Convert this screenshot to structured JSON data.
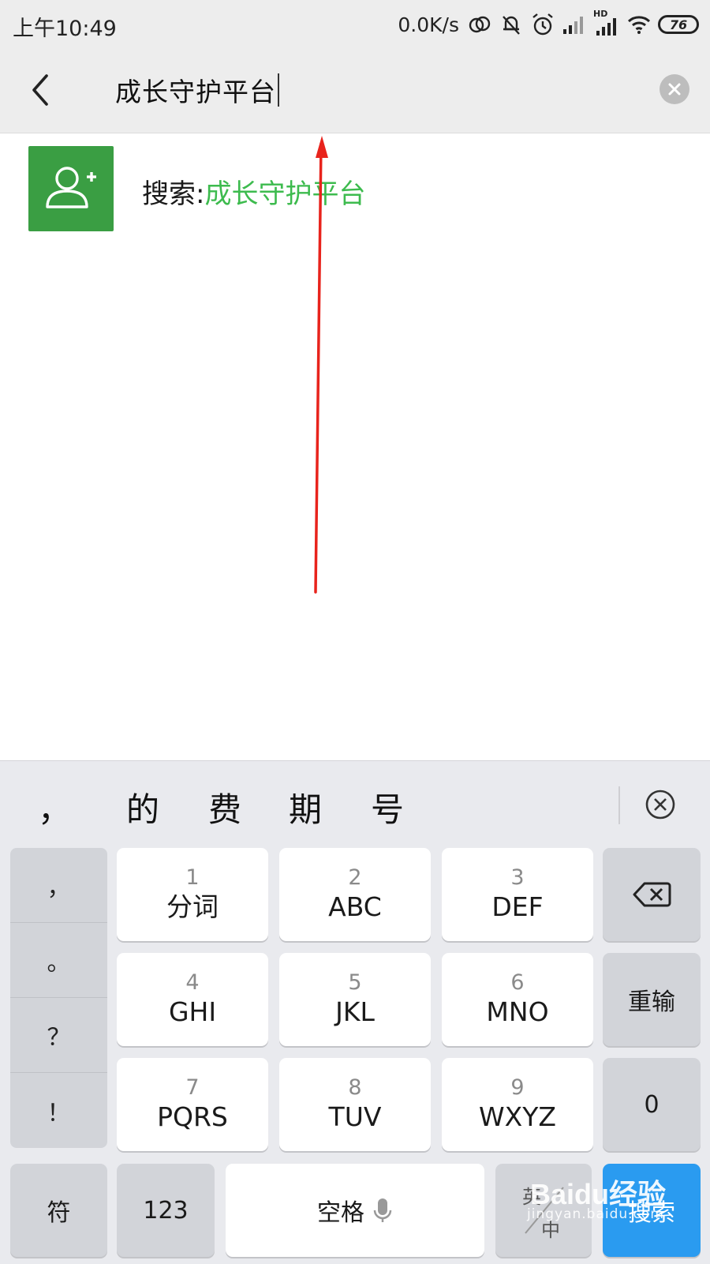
{
  "status_bar": {
    "time": "上午10:49",
    "net_speed": "0.0K/s",
    "network_badge": "HD",
    "battery": "76",
    "icons": [
      "sync-icon",
      "mute-icon",
      "alarm-icon",
      "signal-icon",
      "signal-hd-icon",
      "wifi-icon",
      "battery-icon"
    ]
  },
  "search_header": {
    "back_icon": "chevron-left-icon",
    "query": "成长守护平台",
    "clear_icon": "clear-icon"
  },
  "result": {
    "icon": "add-contact-icon",
    "prefix": "搜索:",
    "query": "成长守护平台",
    "icon_color": "#3a9e43",
    "query_color": "#3dbb4e"
  },
  "keyboard": {
    "candidates": [
      "，",
      "的",
      "费",
      "期",
      "号"
    ],
    "collapse_icon": "collapse-icon",
    "punctuation": [
      "，",
      "。",
      "？",
      "！"
    ],
    "keys": [
      {
        "num": "1",
        "label": "分词"
      },
      {
        "num": "2",
        "label": "ABC"
      },
      {
        "num": "3",
        "label": "DEF"
      },
      {
        "num": "4",
        "label": "GHI"
      },
      {
        "num": "5",
        "label": "JKL"
      },
      {
        "num": "6",
        "label": "MNO"
      },
      {
        "num": "7",
        "label": "PQRS"
      },
      {
        "num": "8",
        "label": "TUV"
      },
      {
        "num": "9",
        "label": "WXYZ"
      }
    ],
    "backspace_icon": "backspace-icon",
    "retype": "重输",
    "zero": "0",
    "symbol": "符",
    "numeric": "123",
    "space": "空格",
    "mic_icon": "mic-icon",
    "lang_top": "英",
    "lang_bottom": "中",
    "search": "搜索",
    "accent": "#2a9bf0"
  },
  "watermark": {
    "logo": "Baidu经验",
    "url": "jingyan.baidu.com"
  }
}
